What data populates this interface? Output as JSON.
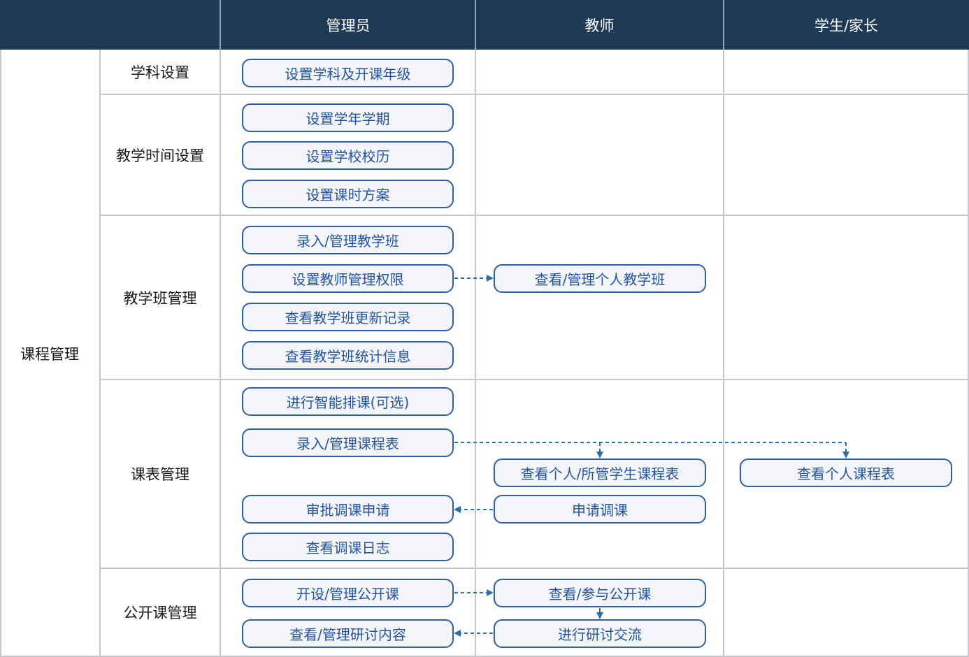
{
  "header": {
    "corner": "",
    "columns": [
      "管理员",
      "教师",
      "学生/家长"
    ]
  },
  "module": "课程管理",
  "sections": [
    {
      "label": "学科设置"
    },
    {
      "label": "教学时间设置"
    },
    {
      "label": "教学班管理"
    },
    {
      "label": "课表管理"
    },
    {
      "label": "公开课管理"
    }
  ],
  "nodes": {
    "a1": "设置学科及开课年级",
    "a2": "设置学年学期",
    "a3": "设置学校校历",
    "a4": "设置课时方案",
    "a5": "录入/管理教学班",
    "a6": "设置教师管理权限",
    "a7": "查看教学班更新记录",
    "a8": "查看教学班统计信息",
    "a9": "进行智能排课(可选)",
    "a10": "录入/管理课程表",
    "a11": "审批调课申请",
    "a12": "查看调课日志",
    "a13": "开设/管理公开课",
    "a14": "查看/管理研讨内容",
    "t1": "查看/管理个人教学班",
    "t2": "查看个人/所管学生课程表",
    "t3": "申请调课",
    "t4": "查看/参与公开课",
    "t5": "进行研讨交流",
    "s1": "查看个人课程表"
  },
  "colors": {
    "header_bg": "#1e3a55",
    "node_border": "#2f5fa8",
    "node_text": "#2554a0",
    "node_bg": "#f3f5f8",
    "arrow": "#2f6fa0",
    "grid": "#c5c9cd"
  }
}
